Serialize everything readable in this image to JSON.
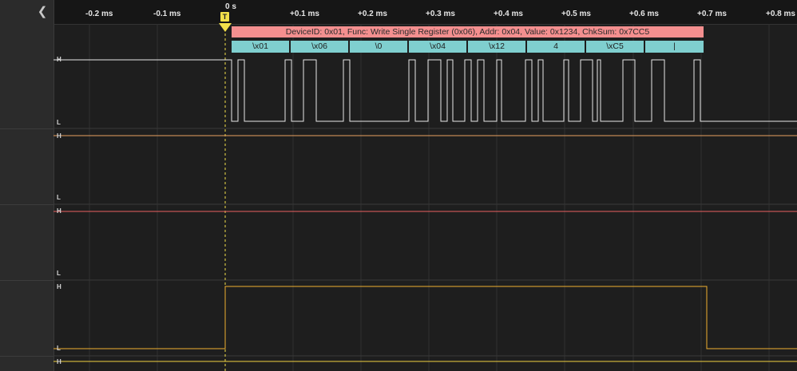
{
  "sidebar": {
    "collapse_icon": "chevron-left-icon"
  },
  "ruler": {
    "zero_label": "0 s",
    "trigger_marker": "T",
    "ticks": [
      "-0.2 ms",
      "-0.1 ms",
      "+0.1 ms",
      "+0.2 ms",
      "+0.3 ms",
      "+0.4 ms",
      "+0.5 ms",
      "+0.6 ms",
      "+0.7 ms",
      "+0.8 ms"
    ]
  },
  "channels": [
    {
      "high_label": "H",
      "low_label": "L",
      "color": "#e8e8e8"
    },
    {
      "high_label": "H",
      "low_label": "L",
      "color": "#e8a060"
    },
    {
      "high_label": "H",
      "low_label": "L",
      "color": "#e86060"
    },
    {
      "high_label": "H",
      "low_label": "L",
      "color": "#f0b030"
    },
    {
      "high_label": "H",
      "color": "#f0d040"
    }
  ],
  "decoder": {
    "frame_label": "DeviceID: 0x01, Func: Write Single Register (0x06), Addr: 0x04, Value: 0x1234, ChkSum: 0x7CC5",
    "frame_color": "#f48f8f",
    "byte_color": "#7fcfcf",
    "bytes": [
      "\\x01",
      "\\x06",
      "\\0",
      "\\x04",
      "\\x12",
      "4",
      "\\xC5",
      "|"
    ]
  },
  "colors": {
    "trigger": "#f2e04a",
    "background": "#1e1e1e"
  }
}
